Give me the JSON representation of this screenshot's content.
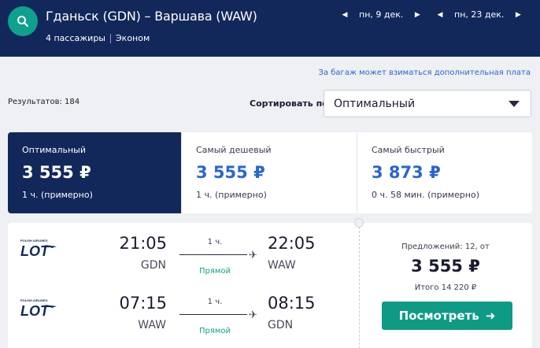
{
  "header": {
    "route": "Гданьск (GDN) – Варшава (WAW)",
    "passengers": "4 пассажиры",
    "cabin": "Эконом",
    "depart_date": "пн, 9 дек.",
    "return_date": "пн, 23 дек."
  },
  "baggage_note": "За багаж может взиматься дополнительная плата",
  "results_count": "Результатов: 184",
  "sort": {
    "label": "Сортировать по",
    "selected": "Оптимальный"
  },
  "sort_tabs": [
    {
      "name": "Оптимальный",
      "price": "3 555 ₽",
      "duration": "1 ч. (примерно)",
      "active": true
    },
    {
      "name": "Самый дешевый",
      "price": "3 555 ₽",
      "duration": "1 ч. (примерно)",
      "active": false
    },
    {
      "name": "Самый быстрый",
      "price": "3 873 ₽",
      "duration": "0 ч. 58 мин. (примерно)",
      "active": false
    }
  ],
  "result": {
    "legs": [
      {
        "airline": "LOT",
        "airline_small": "POLISH AIRLINES",
        "dep_time": "21:05",
        "dep_code": "GDN",
        "arr_time": "22:05",
        "arr_code": "WAW",
        "duration": "1 ч.",
        "stops": "Прямой"
      },
      {
        "airline": "LOT",
        "airline_small": "POLISH AIRLINES",
        "dep_time": "07:15",
        "dep_code": "WAW",
        "arr_time": "08:15",
        "arr_code": "GDN",
        "duration": "1 ч.",
        "stops": "Прямой"
      }
    ],
    "offers": "Предложений: 12, от",
    "price": "3 555 ₽",
    "total": "Итого 14 220 ₽",
    "button": "Посмотреть"
  },
  "colors": {
    "header_bg": "#12285a",
    "accent_teal": "#0f9a86",
    "link_blue": "#2a66cf",
    "direct_green": "#12a28a"
  },
  "icons": [
    "search-icon",
    "chevron-left-icon",
    "chevron-right-icon",
    "chevron-down-icon",
    "plane-icon",
    "arrow-right-icon",
    "lot-logo"
  ]
}
